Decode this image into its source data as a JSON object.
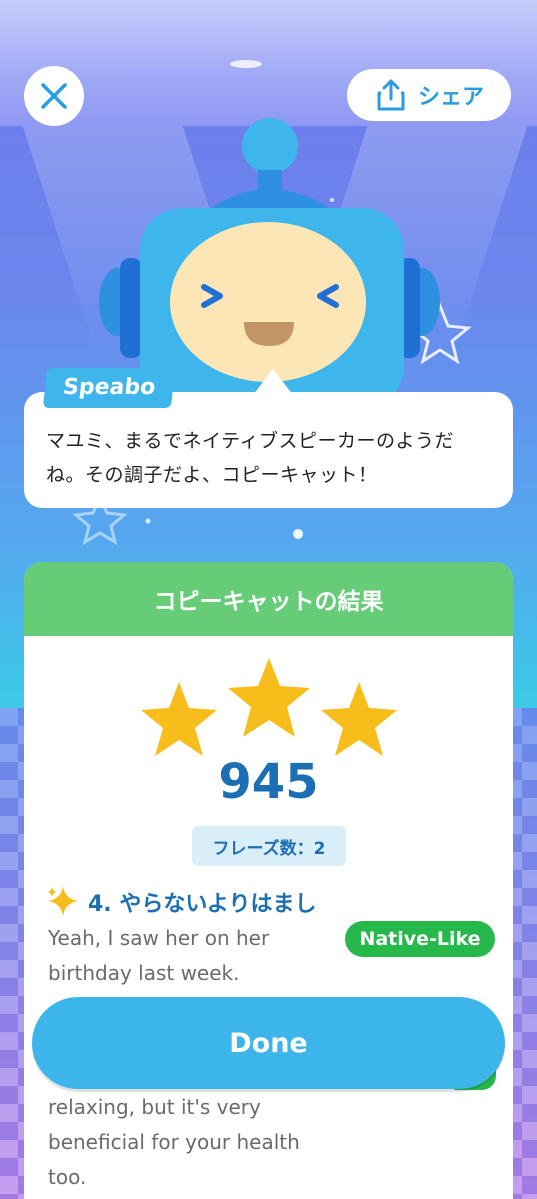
{
  "header": {
    "share_label": "シェア"
  },
  "speech": {
    "name": "Speabo",
    "text_line1": "マユミ、まるでネイティブスピーカーのようだ",
    "text_line2": "ね。その調子だよ、コピーキャット！"
  },
  "result": {
    "title": "コピーキャットの結果",
    "stars": 3,
    "score": "945",
    "phrase_count": "フレーズ数：2"
  },
  "items": [
    {
      "title": "4. やらないよりはまし",
      "badge": "Native-Like",
      "line1": "Yeah, I saw her on her",
      "line2": "birthday last week."
    },
    {
      "line1": "relaxing, but it's very",
      "line2": "beneficial for your health",
      "line3": "too."
    }
  ],
  "footer": {
    "done_label": "Done"
  },
  "colors": {
    "accent_blue": "#3cb5ea",
    "header_green": "#66cc78",
    "badge_green": "#27b84c",
    "score_blue": "#1c6fb5",
    "star_gold": "#f7bd1b"
  },
  "icons": [
    "close-icon",
    "share-icon",
    "star-icon",
    "sparkle-icon"
  ]
}
